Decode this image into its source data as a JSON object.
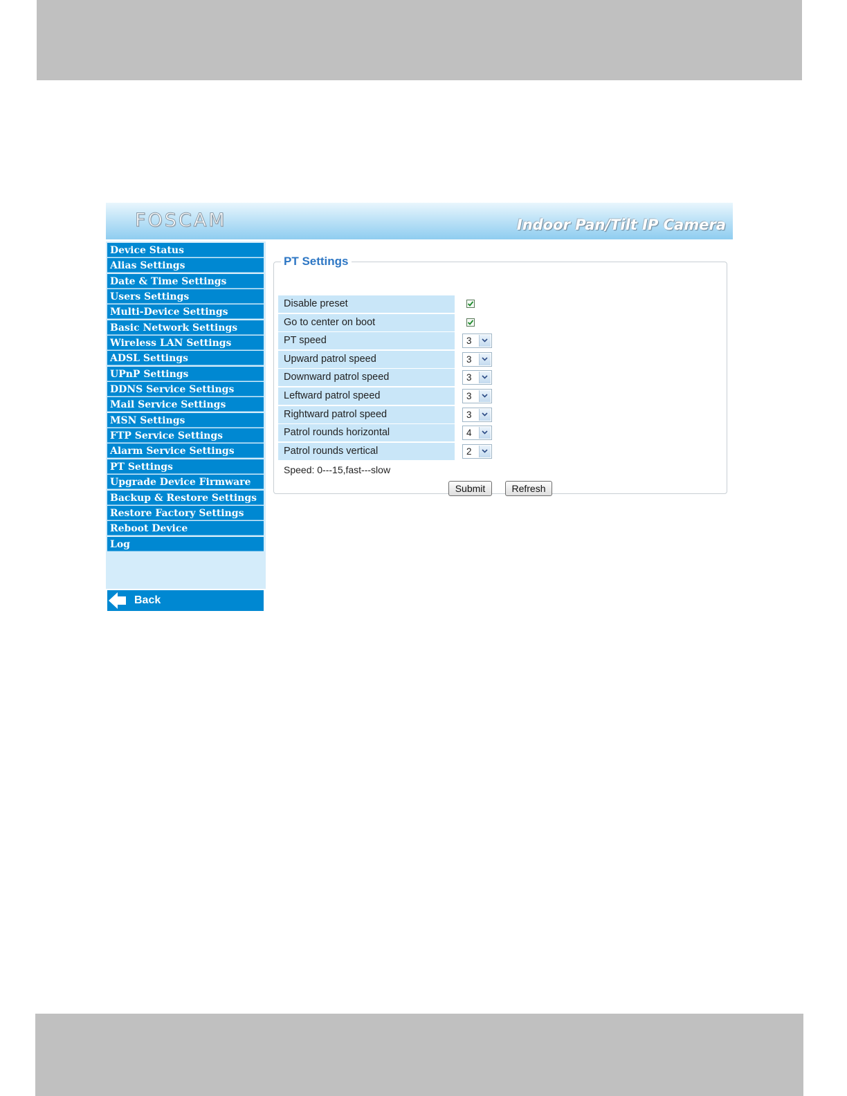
{
  "app": {
    "logo": "FOSCAM",
    "product": "Indoor Pan/Tilt IP Camera"
  },
  "sidebar": {
    "items": [
      {
        "label": "Device Status"
      },
      {
        "label": "Alias Settings"
      },
      {
        "label": "Date & Time Settings"
      },
      {
        "label": "Users Settings"
      },
      {
        "label": "Multi-Device Settings"
      },
      {
        "label": "Basic Network Settings"
      },
      {
        "label": "Wireless LAN Settings"
      },
      {
        "label": "ADSL Settings"
      },
      {
        "label": "UPnP Settings"
      },
      {
        "label": "DDNS Service Settings"
      },
      {
        "label": "Mail Service Settings"
      },
      {
        "label": "MSN Settings"
      },
      {
        "label": "FTP Service Settings"
      },
      {
        "label": "Alarm Service Settings"
      },
      {
        "label": "PT Settings"
      },
      {
        "label": "Upgrade Device Firmware"
      },
      {
        "label": "Backup & Restore Settings"
      },
      {
        "label": "Restore Factory Settings"
      },
      {
        "label": "Reboot Device"
      },
      {
        "label": "Log"
      }
    ],
    "back_label": "Back"
  },
  "pt": {
    "title": "PT Settings",
    "disable_preset": {
      "label": "Disable preset",
      "checked": true
    },
    "center_on_boot": {
      "label": "Go to center on boot",
      "checked": true
    },
    "pt_speed": {
      "label": "PT speed",
      "value": "3"
    },
    "upward": {
      "label": "Upward patrol speed",
      "value": "3"
    },
    "downward": {
      "label": "Downward patrol speed",
      "value": "3"
    },
    "leftward": {
      "label": "Leftward patrol speed",
      "value": "3"
    },
    "rightward": {
      "label": "Rightward patrol speed",
      "value": "3"
    },
    "rounds_h": {
      "label": "Patrol rounds horizontal",
      "value": "4"
    },
    "rounds_v": {
      "label": "Patrol rounds vertical",
      "value": "2"
    },
    "hint": "Speed: 0---15,fast---slow",
    "submit_label": "Submit",
    "refresh_label": "Refresh"
  },
  "colors": {
    "menu_bg": "#0088d2",
    "label_bg": "#c9e6f8",
    "title": "#2e77c4",
    "band": "#c0c0c0"
  }
}
